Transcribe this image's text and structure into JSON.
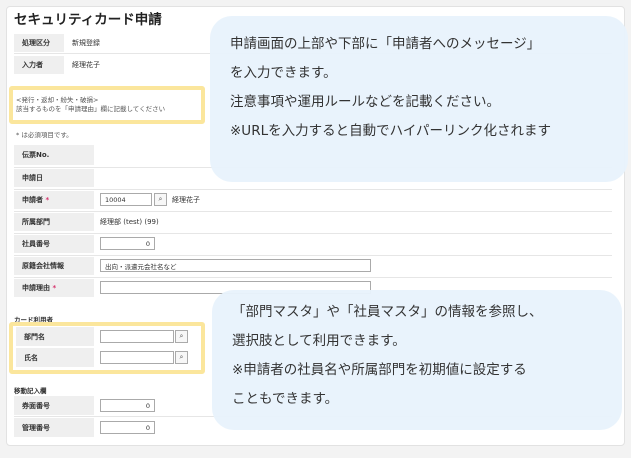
{
  "title": "セキュリティカード申請",
  "top_fields": [
    {
      "label": "処理区分",
      "value": "新規登録"
    },
    {
      "label": "入力者",
      "value": "経理花子"
    }
  ],
  "header_message": {
    "line1": "<発行・返却・紛失・破損>",
    "line2": "該当するものを「申請理由」欄に記載してください"
  },
  "required_note": "* は必須項目です。",
  "form_rows": {
    "slip_no": {
      "label": "伝票No."
    },
    "date": {
      "label": "申請日"
    },
    "applicant": {
      "label": "申請者",
      "mark": "*",
      "code": "10004",
      "name": "経理花子"
    },
    "department": {
      "label": "所属部門",
      "value": "経理部 (test) (99)"
    },
    "employee_no": {
      "label": "社員番号",
      "value": "0"
    },
    "company": {
      "label": "原籍会社情報",
      "placeholder": "出向・派遣元会社名など"
    },
    "reason": {
      "label": "申請理由",
      "mark": "*"
    }
  },
  "card_user": {
    "section": "カード利用者",
    "dept_label": "部門名",
    "name_label": "氏名"
  },
  "admin": {
    "section": "移動記入欄",
    "ticket_label": "券面番号",
    "ticket_value": "0",
    "manage_label": "管理番号",
    "manage_value": "0"
  },
  "bubble1": {
    "lines": [
      "申請画面の上部や下部に「申請者へのメッセージ」",
      "を入力できます。",
      "注意事項や運用ルールなどを記載ください。",
      "※URLを入力すると自動でハイパーリンク化されます"
    ]
  },
  "bubble2": {
    "lines": [
      "「部門マスタ」や「社員マスタ」の情報を参照し、",
      "選択肢として利用できます。",
      "※申請者の社員名や所属部門を初期値に設定する",
      "こともできます。"
    ]
  },
  "icons": {
    "search": "⌕"
  },
  "colors": {
    "highlight": "#fbe69c",
    "bubble": "#e8f2fc",
    "required": "#d6336c"
  }
}
